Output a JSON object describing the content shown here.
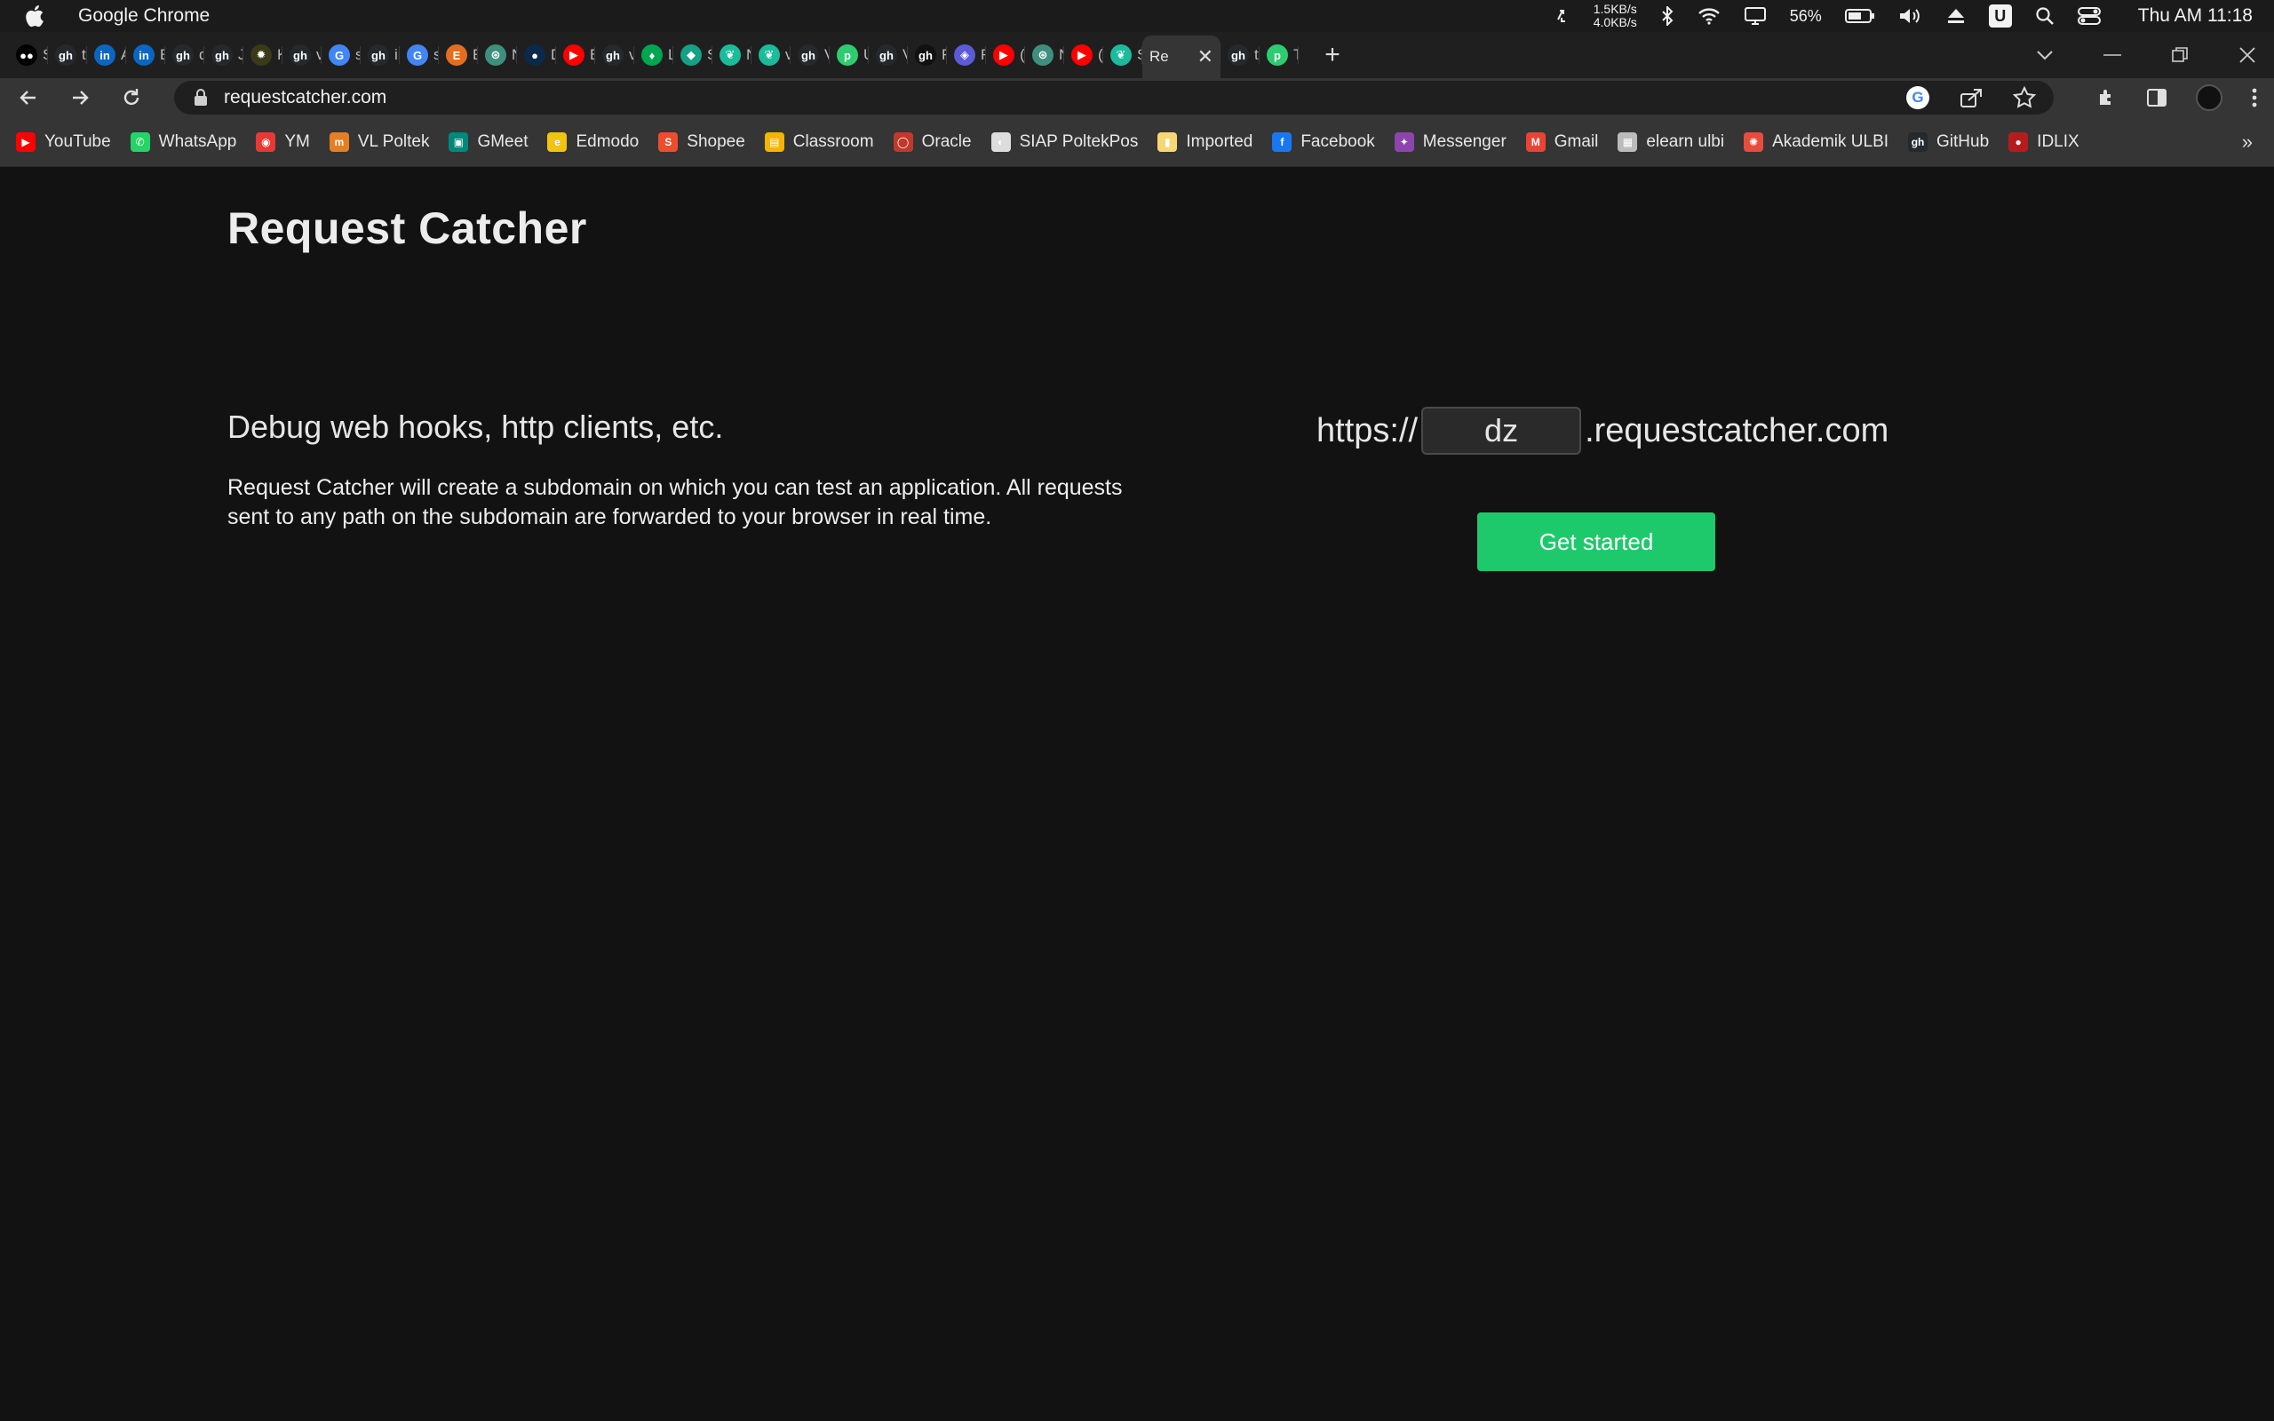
{
  "menubar": {
    "app_name": "Google Chrome",
    "net_up": "1.5KB/s",
    "net_down": "4.0KB/s",
    "battery": "56%",
    "clock": "Thu AM 11:18",
    "u_label": "U"
  },
  "tabs": [
    {
      "label": "S",
      "color": "#000000",
      "glyph": "●●"
    },
    {
      "label": "t",
      "color": "#24292e",
      "glyph": "gh"
    },
    {
      "label": "A",
      "color": "#0a66c2",
      "glyph": "in"
    },
    {
      "label": "E",
      "color": "#0a66c2",
      "glyph": "in"
    },
    {
      "label": "d",
      "color": "#24292e",
      "glyph": "gh"
    },
    {
      "label": "J",
      "color": "#24292e",
      "glyph": "gh"
    },
    {
      "label": "K",
      "color": "#3a3a1a",
      "glyph": "✹"
    },
    {
      "label": "v",
      "color": "#24292e",
      "glyph": "gh"
    },
    {
      "label": "s",
      "color": "#4285f4",
      "glyph": "G"
    },
    {
      "label": "ir",
      "color": "#24292e",
      "glyph": "gh"
    },
    {
      "label": "s",
      "color": "#4285f4",
      "glyph": "G"
    },
    {
      "label": "E",
      "color": "#e56d1f",
      "glyph": "E"
    },
    {
      "label": "N",
      "color": "#3f8f7f",
      "glyph": "⊛"
    },
    {
      "label": "D",
      "color": "#0b2a4a",
      "glyph": "●"
    },
    {
      "label": "B",
      "color": "#ff0000",
      "glyph": "▶"
    },
    {
      "label": "v",
      "color": "#24292e",
      "glyph": "gh"
    },
    {
      "label": "L",
      "color": "#00a650",
      "glyph": "♦"
    },
    {
      "label": "S",
      "color": "#16a085",
      "glyph": "◆"
    },
    {
      "label": "N",
      "color": "#1abc9c",
      "glyph": "❦"
    },
    {
      "label": "v",
      "color": "#1abc9c",
      "glyph": "❦"
    },
    {
      "label": "V",
      "color": "#24292e",
      "glyph": "gh"
    },
    {
      "label": "U",
      "color": "#2ecc71",
      "glyph": "p"
    },
    {
      "label": "V",
      "color": "#24292e",
      "glyph": "gh"
    },
    {
      "label": "F",
      "color": "#111111",
      "glyph": "gh"
    },
    {
      "label": "F",
      "color": "#5b5bd6",
      "glyph": "◈"
    },
    {
      "label": "(",
      "color": "#ff0000",
      "glyph": "▶"
    },
    {
      "label": "N",
      "color": "#3f8f7f",
      "glyph": "⊛"
    },
    {
      "label": "(",
      "color": "#ff0000",
      "glyph": "▶"
    },
    {
      "label": "S",
      "color": "#1abc9c",
      "glyph": "❦"
    }
  ],
  "active_tab": {
    "label": "Re",
    "close": "✕"
  },
  "tabs_after": [
    {
      "label": "t",
      "color": "#24292e",
      "glyph": "gh"
    },
    {
      "label": "T",
      "color": "#2ecc71",
      "glyph": "p"
    }
  ],
  "new_tab": "+",
  "address_bar": {
    "url": "requestcatcher.com"
  },
  "bookmarks": [
    {
      "label": "YouTube",
      "color": "#ff0000",
      "glyph": "▶"
    },
    {
      "label": "WhatsApp",
      "color": "#25d366",
      "glyph": "✆"
    },
    {
      "label": "YM",
      "color": "#e53935",
      "glyph": "◉"
    },
    {
      "label": "VL Poltek",
      "color": "#e67e22",
      "glyph": "m"
    },
    {
      "label": "GMeet",
      "color": "#00897b",
      "glyph": "▣"
    },
    {
      "label": "Edmodo",
      "color": "#f1c40f",
      "glyph": "e"
    },
    {
      "label": "Shopee",
      "color": "#ee4d2d",
      "glyph": "S"
    },
    {
      "label": "Classroom",
      "color": "#f4b400",
      "glyph": "▤"
    },
    {
      "label": "Oracle",
      "color": "#c0392b",
      "glyph": "◯"
    },
    {
      "label": "SIAP PoltekPos",
      "color": "#dddddd",
      "glyph": "◐"
    },
    {
      "label": "Imported",
      "color": "#f7d774",
      "glyph": "▮"
    },
    {
      "label": "Facebook",
      "color": "#1877f2",
      "glyph": "f"
    },
    {
      "label": "Messenger",
      "color": "#8e44ad",
      "glyph": "✦"
    },
    {
      "label": "Gmail",
      "color": "#ea4335",
      "glyph": "M"
    },
    {
      "label": "elearn ulbi",
      "color": "#bbbbbb",
      "glyph": "▦"
    },
    {
      "label": "Akademik ULBI",
      "color": "#e74c3c",
      "glyph": "✺"
    },
    {
      "label": "GitHub",
      "color": "#24292e",
      "glyph": "gh"
    },
    {
      "label": "IDLIX",
      "color": "#b71c1c",
      "glyph": "●"
    }
  ],
  "bookmarks_more": "»",
  "page": {
    "title": "Request Catcher",
    "tagline": "Debug web hooks, http clients, etc.",
    "description": "Request Catcher will create a subdomain on which you can test an application. All requests sent to any path on the subdomain are forwarded to your browser in real time.",
    "url_prefix": "https://",
    "subdomain_value": "dz",
    "url_suffix": ".requestcatcher.com",
    "button_label": "Get started"
  }
}
